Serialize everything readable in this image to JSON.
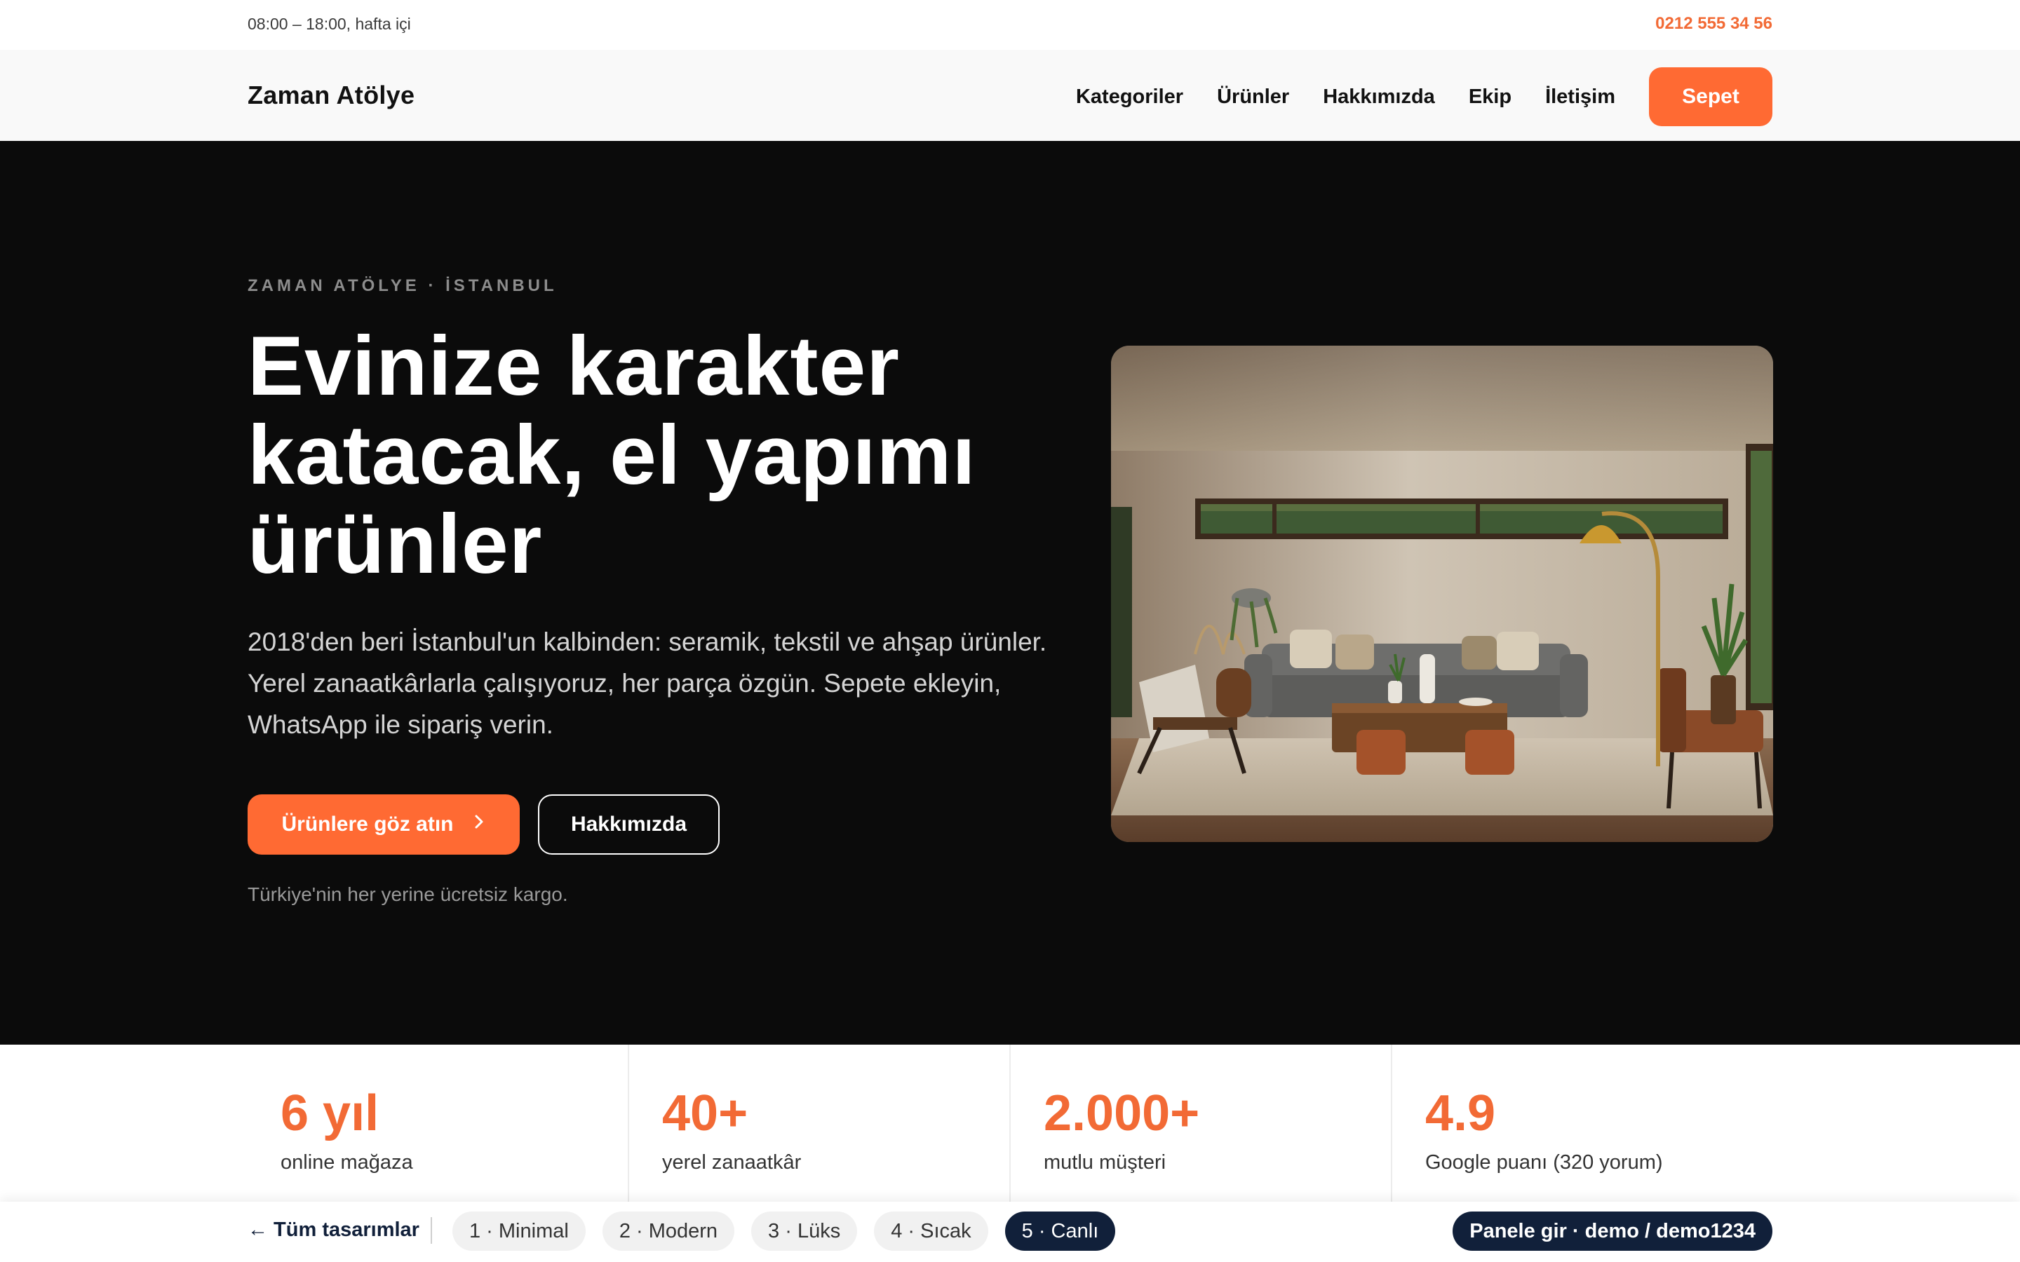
{
  "topbar": {
    "hours": "08:00 – 18:00, hafta içi",
    "phone": "0212 555 34 56"
  },
  "header": {
    "brand": "Zaman Atölye",
    "nav": [
      "Kategoriler",
      "Ürünler",
      "Hakkımızda",
      "Ekip",
      "İletişim"
    ],
    "cart_label": "Sepet"
  },
  "hero": {
    "eyebrow": "ZAMAN ATÖLYE · İSTANBUL",
    "title": "Evinize karakter katacak, el yapımı ürünler",
    "description": "2018'den beri İstanbul'un kalbinden: seramik, tekstil ve ahşap ürünler. Yerel zanaatkârlarla çalışıyoruz, her parça özgün. Sepete ekleyin, WhatsApp ile sipariş verin.",
    "primary_button": "Ürünlere göz atın",
    "primary_icon": "chevron-right-icon",
    "secondary_button": "Hakkımızda",
    "shipping_note": "Türkiye'nin her yerine ücretsiz kargo."
  },
  "stats": [
    {
      "value": "6 yıl",
      "label": "online mağaza"
    },
    {
      "value": "40+",
      "label": "yerel zanaatkâr"
    },
    {
      "value": "2.000+",
      "label": "mutlu müşteri"
    },
    {
      "value": "4.9",
      "label": "Google puanı (320 yorum)"
    }
  ],
  "bottombar": {
    "back_label": "← Tüm tasarımlar",
    "designs": [
      "1 · Minimal",
      "2 · Modern",
      "3 · Lüks",
      "4 · Sıcak",
      "5 · Canlı"
    ],
    "active_design": "5 · Canlı",
    "panel_label": "Panele gir · demo / demo1234"
  },
  "colors": {
    "accent": "#ff6a33",
    "hero_bg": "#0b0b0b",
    "navy": "#11203a"
  }
}
